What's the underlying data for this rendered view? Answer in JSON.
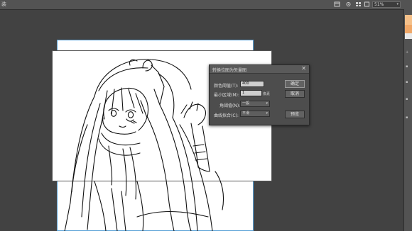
{
  "app": {
    "tab_label": "装"
  },
  "toolbar": {
    "zoom_value": "51%"
  },
  "dialog": {
    "title": "转换位图为矢量图",
    "close_glyph": "✕",
    "fields": {
      "color_threshold": {
        "label": "颜色阈值(T):",
        "value": "400"
      },
      "min_area": {
        "label": "最小区域(M):",
        "value": "1",
        "unit": "像素"
      },
      "corner_threshold": {
        "label": "角阈值(N):",
        "value": "一般"
      },
      "curve_fit": {
        "label": "曲线拟合(C):",
        "value": "平滑"
      }
    },
    "buttons": {
      "ok": "确定",
      "cancel": "取消",
      "preview": "预览"
    }
  },
  "colors": {
    "accent_swatch_1": "#f5c089",
    "accent_swatch_2": "#f0a868",
    "artboard_guide": "#57a0d6"
  }
}
